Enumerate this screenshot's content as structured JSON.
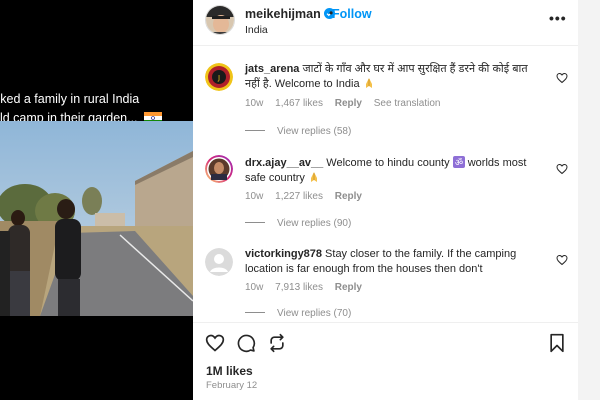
{
  "post": {
    "caption_lines": [
      "sked a family in rural India",
      "uld camp in their garden..."
    ],
    "flag_icon": "india-flag-icon"
  },
  "header": {
    "username": "meikehijman",
    "dot": "•",
    "follow_label": "Follow",
    "location": "India",
    "more_label": "•••"
  },
  "comments": [
    {
      "username": "jats_arena",
      "text": "जाटों के गाँव और घर में आप सुरक्षित हैं डरने की कोई बात नहीं है. Welcome to India",
      "emoji": "folded-hands-icon",
      "age": "10w",
      "likes": "1,467 likes",
      "reply_label": "Reply",
      "translate_label": "See translation",
      "view_replies": "View replies (58)"
    },
    {
      "username": "drx.ajay__av__",
      "text_before": "Welcome to hindu county",
      "text_after": "worlds most safe country",
      "emoji": "om-icon",
      "emoji2": "folded-hands-icon",
      "age": "10w",
      "likes": "1,227 likes",
      "reply_label": "Reply",
      "view_replies": "View replies (90)"
    },
    {
      "username": "victorkingy878",
      "text": "Stay closer to the family. If the camping location is far enough from the houses then don't",
      "age": "10w",
      "likes": "7,913 likes",
      "reply_label": "Reply",
      "view_replies": "View replies (70)"
    }
  ],
  "footer": {
    "likes": "1M likes",
    "date": "February 12"
  },
  "colors": {
    "accent": "#0095f6",
    "muted": "#8e8e8e",
    "text": "#262626"
  }
}
